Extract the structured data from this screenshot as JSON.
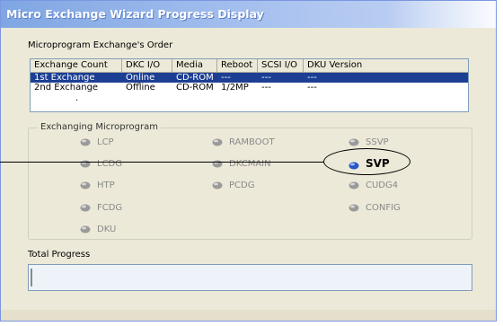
{
  "window": {
    "title": "Micro Exchange Wizard Progress Display"
  },
  "order": {
    "label": "Microprogram Exchange's Order",
    "columns": [
      "Exchange Count",
      "DKC I/O",
      "Media",
      "Reboot",
      "SCSI I/O",
      "DKU Version"
    ],
    "rows": [
      {
        "count": "1st Exchange",
        "dkc": "Online",
        "media": "CD-ROM",
        "reboot": "---",
        "scsi": "---",
        "dku": "---",
        "selected": true
      },
      {
        "count": "2nd Exchange",
        "dkc": "Offline",
        "media": "CD-ROM",
        "reboot": "1/2MP",
        "scsi": "---",
        "dku": "---",
        "selected": false
      }
    ],
    "extra_dot": "."
  },
  "exchanging": {
    "label": "Exchanging Microprogram",
    "items": {
      "lcp": "LCP",
      "ramboot": "RAMBOOT",
      "ssvp": "SSVP",
      "lcdg": "LCDG",
      "dkcmain": "DKCMAIN",
      "svp": "SVP",
      "htp": "HTP",
      "pcdg": "PCDG",
      "cudg4": "CUDG4",
      "fcdg": "FCDG",
      "config": "CONFIG",
      "dku": "DKU"
    },
    "active_item": "SVP",
    "colors": {
      "inactive_led": "#9a9a9a",
      "active_led": "#2a56c6"
    }
  },
  "total": {
    "label": "Total Progress",
    "progress": 0
  }
}
